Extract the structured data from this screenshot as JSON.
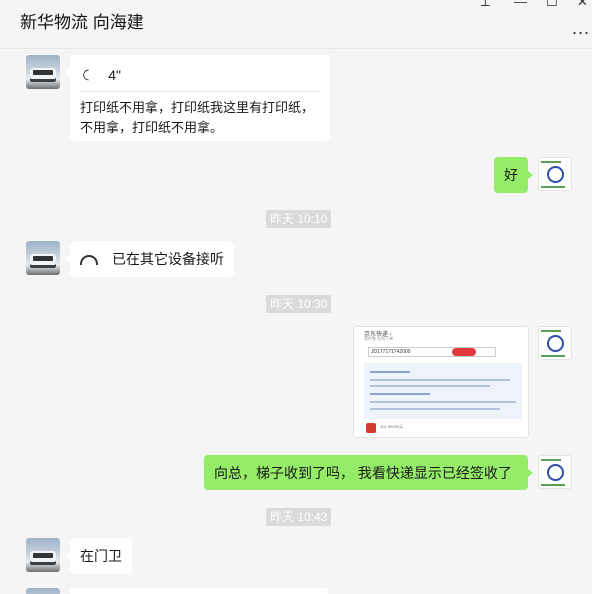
{
  "window": {
    "title": "新华物流 向海建",
    "controls": {
      "pin": "⟂",
      "minimize": "—",
      "maximize": "☐",
      "close": "✕"
    },
    "more": "..."
  },
  "messages": {
    "voice": {
      "duration": "4\"",
      "transcript": "打印纸不用拿，打印纸我这里有打印纸，不用拿，打印纸不用拿。"
    },
    "reply_1": "好",
    "ts_1": "昨天 10:10",
    "call": "已在其它设备接听",
    "ts_2": "昨天 10:30",
    "screenshot": {
      "title": "京东快递 ›",
      "subtitle": "寄件查 在线下单",
      "tracking": "JD1771?1?42000",
      "footer": "JDL ¥5000元"
    },
    "reply_2": "向总，梯子收到了吗， 我看快递显示已经签收了",
    "ts_3": "昨天 10:43",
    "reply_3": "在门卫"
  },
  "colors": {
    "green_bubble": "#95ec69",
    "background": "#f5f5f5",
    "timestamp_bg": "#dadada"
  }
}
